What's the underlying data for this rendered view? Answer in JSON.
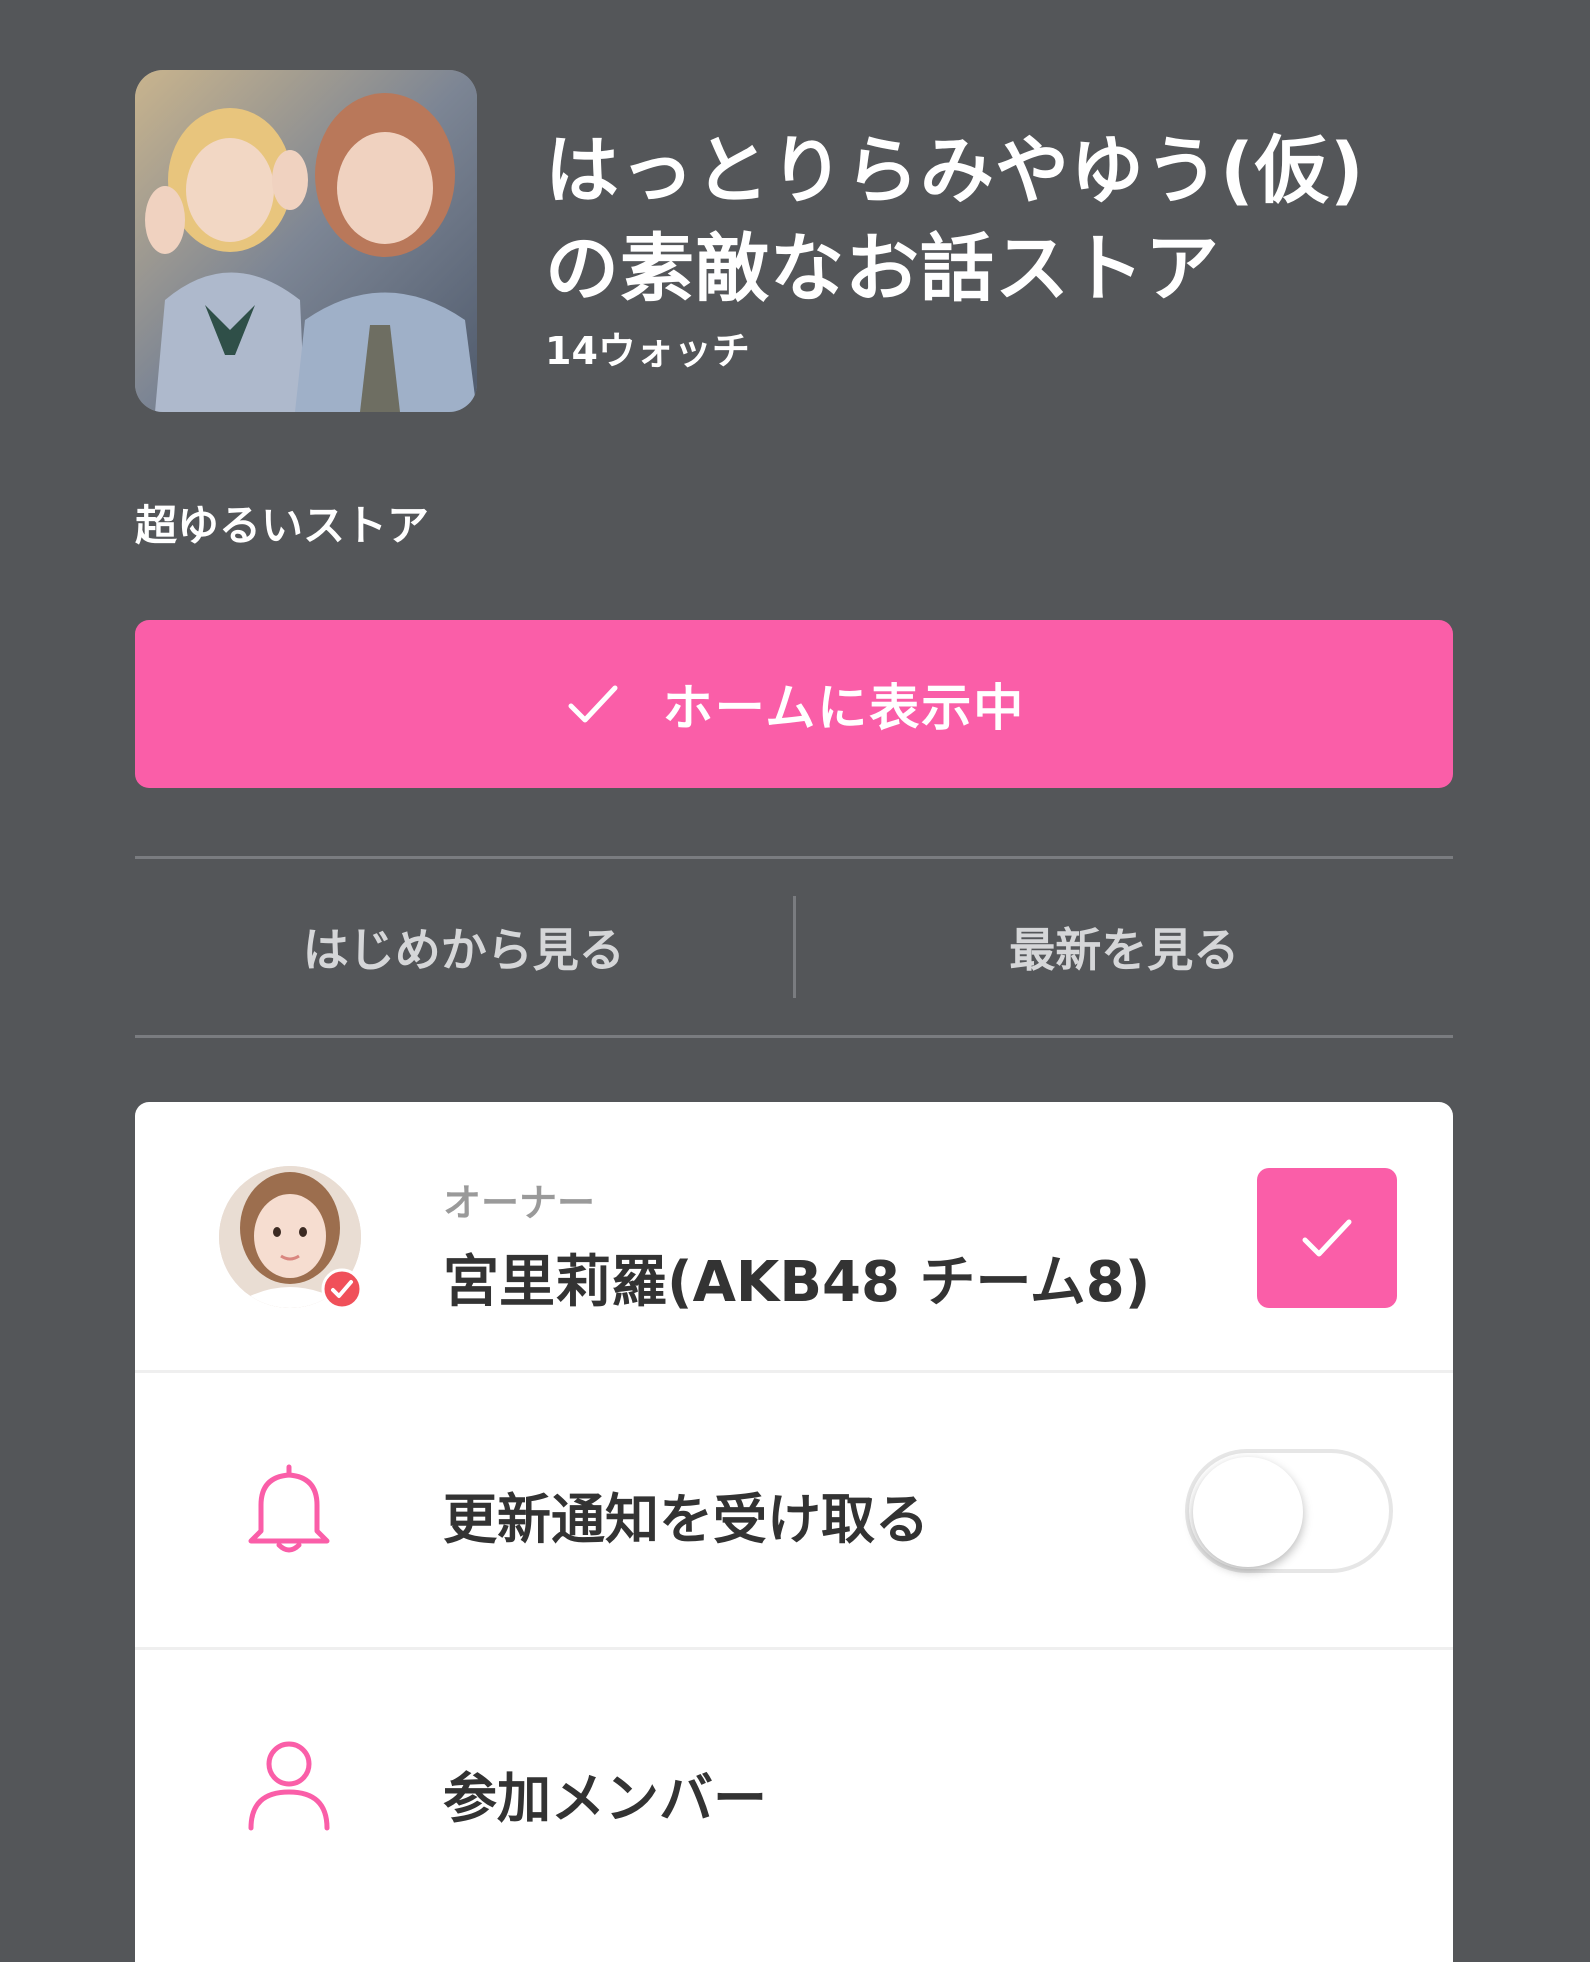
{
  "store": {
    "title_line1": "はっとりらみやゆう(仮)",
    "title_line2": "の素敵なお話ストア",
    "watch_count": "14ウォッチ",
    "description": "超ゆるいストア",
    "thumbnail_icon": "store-photo"
  },
  "actions": {
    "home_button_label": "ホームに表示中",
    "read_from_start": "はじめから見る",
    "read_latest": "最新を見る"
  },
  "owner": {
    "label": "オーナー",
    "name": "宮里莉羅(AKB48 チーム8)",
    "avatar_icon": "owner-avatar",
    "verified": true,
    "following": true
  },
  "notifications": {
    "label": "更新通知を受け取る",
    "enabled": false,
    "icon": "bell-icon"
  },
  "members": {
    "label": "参加メンバー",
    "icon": "person-icon"
  },
  "colors": {
    "background": "#545659",
    "accent": "#fa5ea8",
    "card": "#ffffff",
    "text_dark": "#333333",
    "text_muted": "#9a9a9a"
  }
}
